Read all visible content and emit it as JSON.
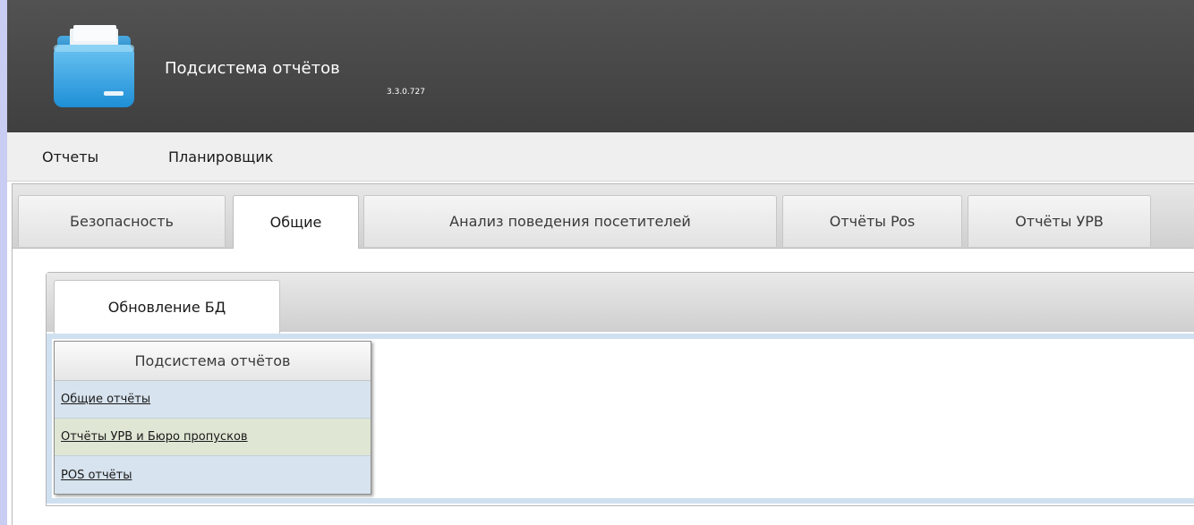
{
  "header": {
    "title": "Подсистема отчётов",
    "version": "3.3.0.727",
    "icon": "folder-icon"
  },
  "menu": {
    "items": [
      "Отчеты",
      "Планировщик"
    ]
  },
  "tabs": [
    {
      "label": "Безопасность"
    },
    {
      "label": "Общие"
    },
    {
      "label": "Анализ поведения посетителей"
    },
    {
      "label": "Отчёты Pos"
    },
    {
      "label": "Отчёты УРВ"
    }
  ],
  "active_tab": "Общие",
  "subtabs": [
    {
      "label": "Обновление БД"
    }
  ],
  "report_list": {
    "header": "Подсистема отчётов",
    "items": [
      "Общие отчёты",
      "Отчёты УРВ и Бюро пропусков",
      "POS отчёты"
    ]
  },
  "colors": {
    "header_bg": "#474747",
    "content_border": "#cfe0f0",
    "list_bg": "#d7e3ee",
    "list_hover": "#dfe7d4"
  }
}
